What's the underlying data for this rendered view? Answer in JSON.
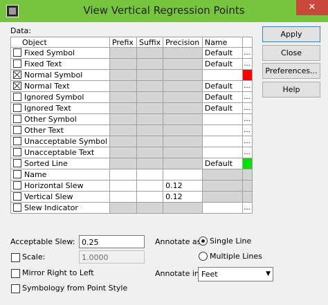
{
  "window": {
    "title": "View Vertical Regression Points",
    "close": "✕"
  },
  "data_label": "Data:",
  "table": {
    "headers": [
      "Object",
      "Prefix",
      "Suffix",
      "Precision",
      "Name",
      ""
    ],
    "rows": [
      {
        "checked": false,
        "object": "Fixed Symbol",
        "prefix_gray": true,
        "precision": "",
        "precision_gray": true,
        "name": "Default",
        "name_gray": false,
        "extra": "dots"
      },
      {
        "checked": false,
        "object": "Fixed Text",
        "prefix_gray": true,
        "precision": "",
        "precision_gray": true,
        "name": "Default",
        "name_gray": false,
        "extra": "dots"
      },
      {
        "checked": true,
        "object": "Normal Symbol",
        "prefix_gray": true,
        "precision": "",
        "precision_gray": true,
        "name": "",
        "name_gray": false,
        "extra": "red"
      },
      {
        "checked": true,
        "object": "Normal Text",
        "prefix_gray": true,
        "precision": "",
        "precision_gray": true,
        "name": "Default",
        "name_gray": false,
        "extra": "dots"
      },
      {
        "checked": false,
        "object": "Ignored Symbol",
        "prefix_gray": true,
        "precision": "",
        "precision_gray": true,
        "name": "Default",
        "name_gray": false,
        "extra": "dots"
      },
      {
        "checked": false,
        "object": "Ignored Text",
        "prefix_gray": true,
        "precision": "",
        "precision_gray": true,
        "name": "Default",
        "name_gray": false,
        "extra": "dots"
      },
      {
        "checked": false,
        "object": "Other Symbol",
        "prefix_gray": true,
        "precision": "",
        "precision_gray": true,
        "name": "",
        "name_gray": false,
        "extra": "dots"
      },
      {
        "checked": false,
        "object": "Other Text",
        "prefix_gray": true,
        "precision": "",
        "precision_gray": true,
        "name": "",
        "name_gray": false,
        "extra": "dots"
      },
      {
        "checked": false,
        "object": "Unacceptable Symbol",
        "prefix_gray": true,
        "precision": "",
        "precision_gray": true,
        "name": "",
        "name_gray": false,
        "extra": "dots"
      },
      {
        "checked": false,
        "object": "Unacceptable Text",
        "prefix_gray": true,
        "precision": "",
        "precision_gray": true,
        "name": "",
        "name_gray": false,
        "extra": "dots"
      },
      {
        "checked": false,
        "object": "Sorted Line",
        "prefix_gray": true,
        "precision": "",
        "precision_gray": true,
        "name": "Default",
        "name_gray": false,
        "extra": "green"
      },
      {
        "checked": false,
        "object": "Name",
        "prefix_gray": false,
        "precision": "",
        "precision_gray": false,
        "name": "",
        "name_gray": true,
        "extra": "gray"
      },
      {
        "checked": false,
        "object": "Horizontal Slew",
        "prefix_gray": false,
        "precision": "0.12",
        "precision_gray": false,
        "name": "",
        "name_gray": true,
        "extra": "gray"
      },
      {
        "checked": false,
        "object": "Vertical Slew",
        "prefix_gray": false,
        "precision": "0.12",
        "precision_gray": false,
        "name": "",
        "name_gray": true,
        "extra": "gray"
      },
      {
        "checked": false,
        "object": "Slew Indicator",
        "prefix_gray": true,
        "precision": "",
        "precision_gray": true,
        "name": "",
        "name_gray": false,
        "extra": "dots"
      }
    ],
    "dots_label": "..."
  },
  "buttons": {
    "apply": "Apply",
    "close": "Close",
    "preferences": "Preferences...",
    "help": "Help"
  },
  "acceptable_slew": {
    "label": "Acceptable Slew:",
    "value": "0.25"
  },
  "scale": {
    "label": "Scale:",
    "value": "1.0000",
    "checked": false
  },
  "mirror": {
    "label": "Mirror Right to Left",
    "checked": false
  },
  "symbology": {
    "label": "Symbology from Point Style",
    "checked": false
  },
  "annotate_as": {
    "label": "Annotate as:",
    "options": [
      "Single Line",
      "Multiple Lines"
    ],
    "selected": "Single Line"
  },
  "annotate_in": {
    "label": "Annotate in:",
    "value": "Feet"
  },
  "colors": {
    "red": "#ff0000",
    "green": "#00e000",
    "title_bar": "#77c43f",
    "gray_cell": "#d4d4d4"
  }
}
